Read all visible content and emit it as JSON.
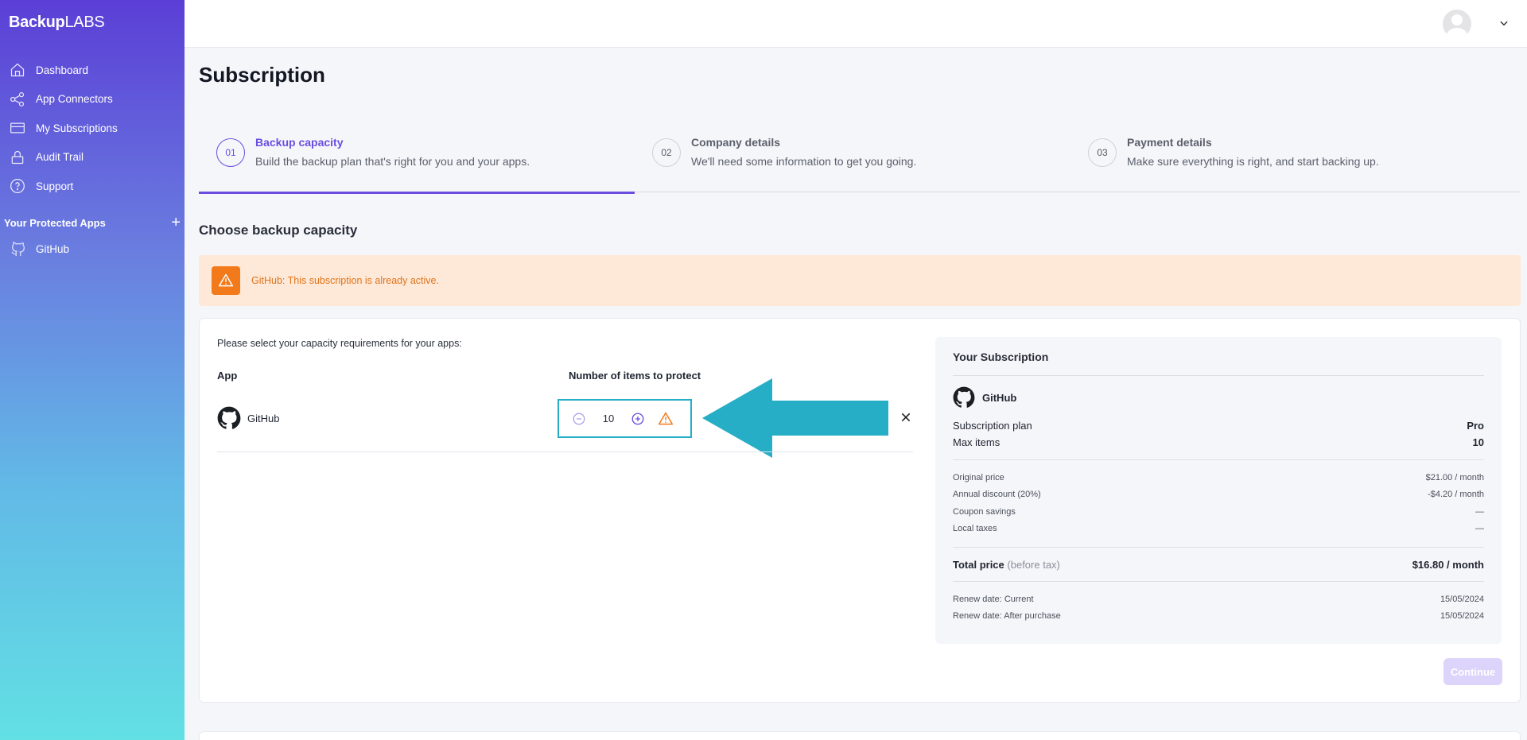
{
  "brand": {
    "logo_bold": "Backup",
    "logo_light": "LABS"
  },
  "sidebar": {
    "items": [
      {
        "label": "Dashboard",
        "icon": "home-icon"
      },
      {
        "label": "App Connectors",
        "icon": "share-icon"
      },
      {
        "label": "My Subscriptions",
        "icon": "card-icon"
      },
      {
        "label": "Audit Trail",
        "icon": "lock-icon"
      },
      {
        "label": "Support",
        "icon": "help-icon"
      }
    ],
    "protected_title": "Your Protected Apps",
    "protected_apps": [
      {
        "label": "GitHub",
        "icon": "github-icon"
      }
    ]
  },
  "page": {
    "title": "Subscription"
  },
  "steps": [
    {
      "num": "01",
      "title": "Backup capacity",
      "subtitle": "Build the backup plan that's right for you and your apps."
    },
    {
      "num": "02",
      "title": "Company details",
      "subtitle": "We'll need some information to get you going."
    },
    {
      "num": "03",
      "title": "Payment details",
      "subtitle": "Make sure everything is right, and start backing up."
    }
  ],
  "choose_title": "Choose backup capacity",
  "alert": {
    "text": "GitHub: This subscription is already active.",
    "color": "#f27a1a"
  },
  "capacity": {
    "instruction": "Please select your capacity requirements for your apps:",
    "col_app": "App",
    "col_items": "Number of items to protect",
    "rows": [
      {
        "app": "GitHub",
        "quantity": "10"
      }
    ]
  },
  "summary": {
    "title": "Your Subscription",
    "app": "GitHub",
    "plan_label": "Subscription plan",
    "plan_value": "Pro",
    "max_label": "Max items",
    "max_value": "10",
    "original_label": "Original price",
    "original_value": "$21.00 / month",
    "discount_label": "Annual discount (20%)",
    "discount_value": "-$4.20 / month",
    "coupon_label": "Coupon savings",
    "coupon_value": "—",
    "taxes_label": "Local taxes",
    "taxes_value": "—",
    "total_label": "Total price",
    "total_note": "(before tax)",
    "total_value": "$16.80 / month",
    "renew_current_label": "Renew date: Current",
    "renew_current_value": "15/05/2024",
    "renew_after_label": "Renew date: After purchase",
    "renew_after_value": "15/05/2024"
  },
  "continue_label": "Continue",
  "colors": {
    "accent": "#6b4ee0",
    "highlight": "#25aec6",
    "warning": "#f27a1a"
  }
}
